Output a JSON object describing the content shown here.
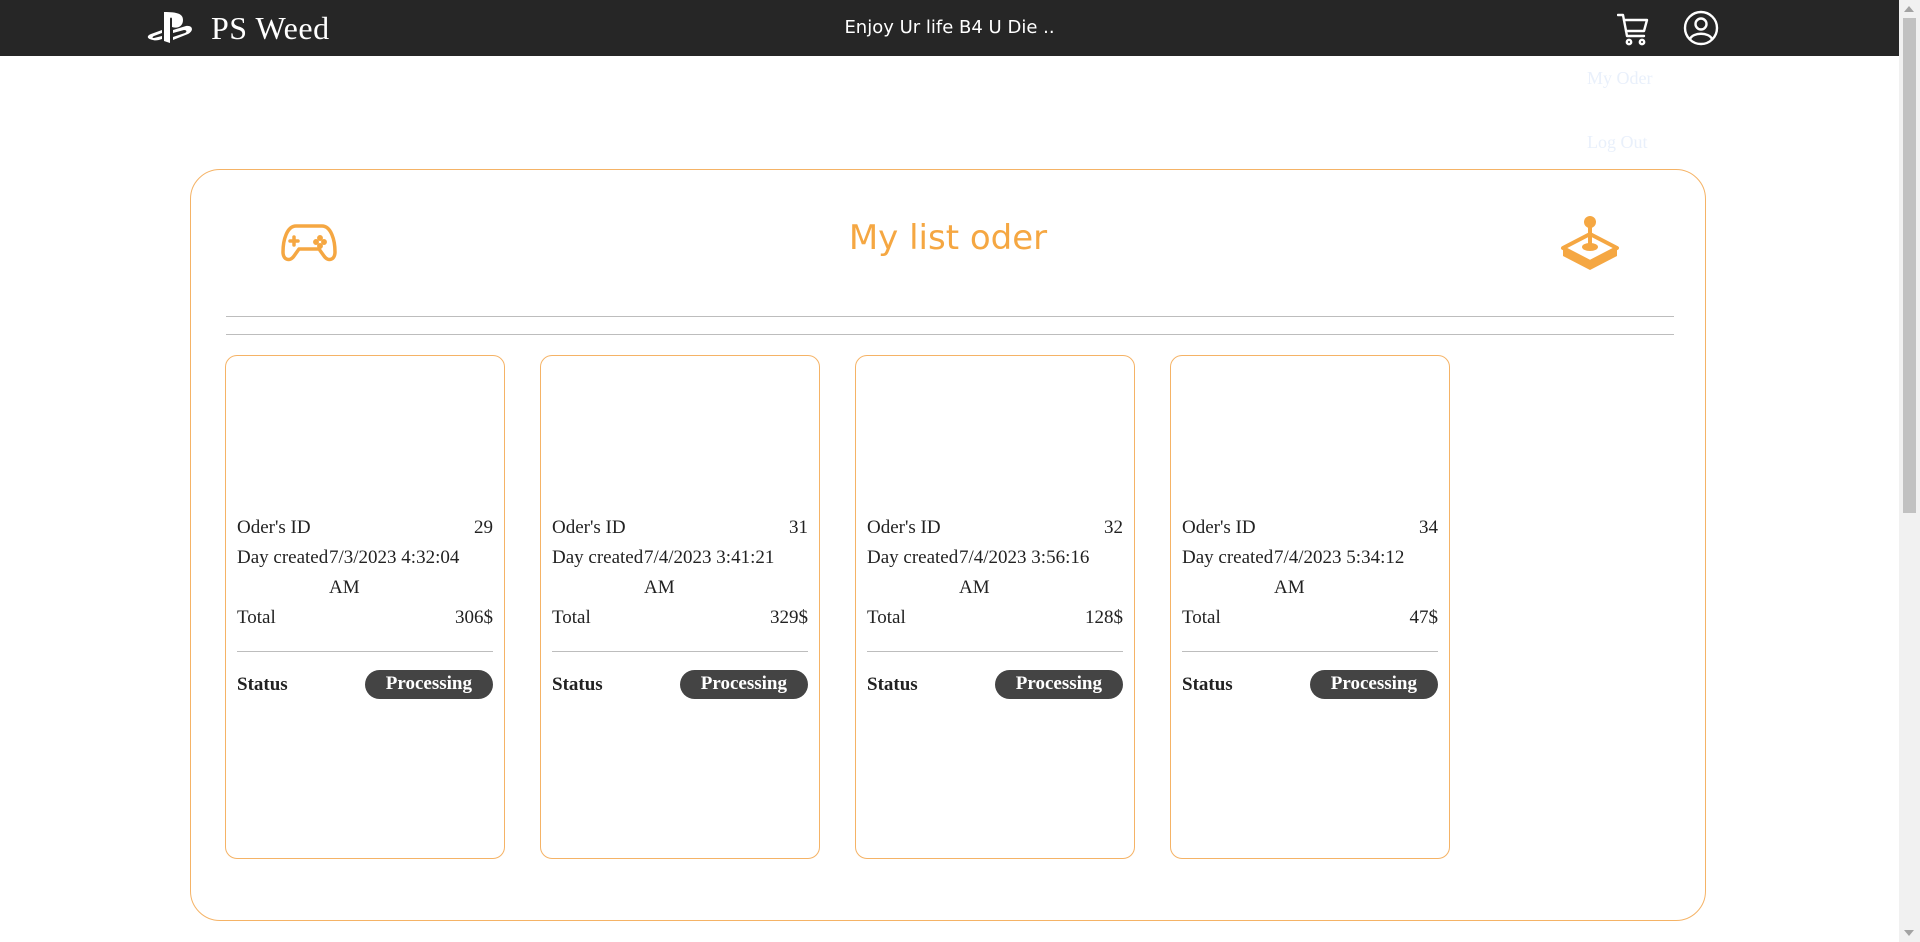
{
  "header": {
    "brand": "PS Weed",
    "tagline": "Enjoy Ur life B4 U Die ..",
    "cart_icon": "cart-icon",
    "account_icon": "user-circle-icon",
    "logo_icon": "playstation-logo-icon"
  },
  "account_menu": {
    "my_order": "My Oder",
    "logout": "Log Out"
  },
  "page": {
    "title": "My list oder",
    "left_icon": "gamepad-icon",
    "right_icon": "joystick-icon",
    "accent_color": "#f5a742"
  },
  "orders": [
    {
      "id_label": "Oder's ID",
      "id": "29",
      "day_label": "Day created",
      "day": "7/3/2023 4:32:04 AM",
      "total_label": "Total",
      "total": "306$",
      "status_label": "Status",
      "status": "Processing"
    },
    {
      "id_label": "Oder's ID",
      "id": "31",
      "day_label": "Day created",
      "day": "7/4/2023 3:41:21 AM",
      "total_label": "Total",
      "total": "329$",
      "status_label": "Status",
      "status": "Processing"
    },
    {
      "id_label": "Oder's ID",
      "id": "32",
      "day_label": "Day created",
      "day": "7/4/2023 3:56:16 AM",
      "total_label": "Total",
      "total": "128$",
      "status_label": "Status",
      "status": "Processing"
    },
    {
      "id_label": "Oder's ID",
      "id": "34",
      "day_label": "Day created",
      "day": "7/4/2023 5:34:12 AM",
      "total_label": "Total",
      "total": "47$",
      "status_label": "Status",
      "status": "Processing"
    }
  ]
}
